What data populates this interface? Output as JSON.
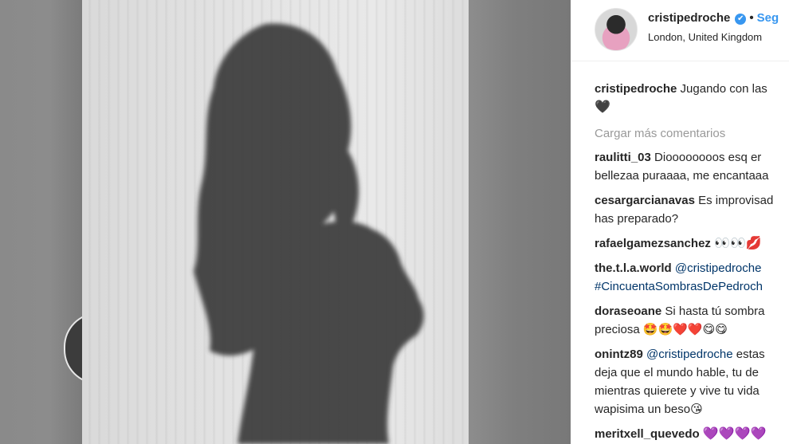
{
  "post": {
    "username": "cristipedroche",
    "verified_mark": "✔",
    "separator": "•",
    "follow_label": "Seg",
    "location": "London, United Kingdom"
  },
  "caption": {
    "username": "cristipedroche",
    "text": "Jugando con las",
    "emoji": "🖤"
  },
  "load_more": "Cargar más comentarios",
  "comments": [
    {
      "username": "raulitti_03",
      "lines": [
        "Dioooooooos esq er",
        "bellezaa puraaaa, me encantaaa"
      ]
    },
    {
      "username": "cesargarcianavas",
      "lines": [
        "Es improvisad",
        "has preparado?"
      ]
    },
    {
      "username": "rafaelgamezsanchez",
      "lines": [
        "👀👀💋"
      ]
    },
    {
      "username": "the.t.l.a.world",
      "mention": "@cristipedroche",
      "lines": [
        "#CincuentaSombrasDePedroch"
      ]
    },
    {
      "username": "doraseoane",
      "lines": [
        "Si hasta tú sombra",
        "preciosa 🤩🤩❤️❤️😋😋"
      ]
    },
    {
      "username": "onintz89",
      "mention": "@cristipedroche",
      "lines": [
        "estas",
        "deja que el mundo hable, tu de",
        "mientras quierete y vive tu vida",
        "wapisima un beso😘"
      ]
    },
    {
      "username": "meritxell_quevedo",
      "lines": [
        "💜💜💜💜"
      ]
    }
  ],
  "icons": {
    "verified": "verified-badge-icon",
    "avatar": "profile-avatar"
  },
  "colors": {
    "link": "#3897f0",
    "text": "#262626",
    "muted": "#999999",
    "mention": "#003569"
  }
}
